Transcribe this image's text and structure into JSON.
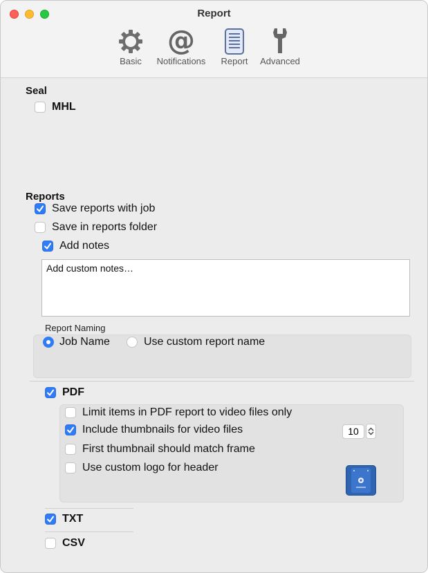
{
  "window": {
    "title": "Report"
  },
  "toolbar": {
    "items": [
      {
        "label": "Basic",
        "icon": "gear-icon"
      },
      {
        "label": "Notifications",
        "icon": "at-sign-icon"
      },
      {
        "label": "Report",
        "icon": "report-document-icon",
        "selected": true
      },
      {
        "label": "Advanced",
        "icon": "wrench-icon"
      }
    ]
  },
  "seal": {
    "title": "Seal",
    "mhl": {
      "label": "MHL",
      "checked": false
    }
  },
  "reports": {
    "title": "Reports",
    "save_with_job": {
      "label": "Save reports with job",
      "checked": true
    },
    "save_in_folder": {
      "label": "Save in reports folder",
      "checked": false
    },
    "add_notes": {
      "label": "Add notes",
      "checked": true
    },
    "notes_placeholder": "Add custom notes…",
    "naming": {
      "title": "Report Naming",
      "options": [
        {
          "label": "Job Name",
          "selected": true
        },
        {
          "label": "Use custom report name",
          "selected": false
        }
      ]
    }
  },
  "pdf": {
    "label": "PDF",
    "checked": true,
    "options": {
      "limit_video": {
        "label": "Limit items in PDF report to video files only",
        "checked": false
      },
      "thumbnails": {
        "label": "Include thumbnails for video files",
        "checked": true
      },
      "first_thumb": {
        "label": "First thumbnail should match frame",
        "checked": false
      },
      "custom_logo": {
        "label": "Use custom logo for header",
        "checked": false
      }
    },
    "thumbnail_count": "10"
  },
  "txt": {
    "label": "TXT",
    "checked": true
  },
  "csv": {
    "label": "CSV",
    "checked": false
  },
  "colors": {
    "accent": "#2f7cf6"
  }
}
